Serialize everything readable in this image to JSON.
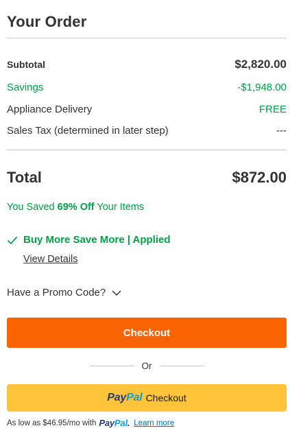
{
  "header": {
    "title": "Your Order"
  },
  "summary": {
    "subtotal": {
      "label": "Subtotal",
      "value": "$2,820.00"
    },
    "savings": {
      "label": "Savings",
      "value": "-$1,948.00"
    },
    "delivery": {
      "label": "Appliance Delivery",
      "value": "FREE"
    },
    "tax": {
      "label": "Sales Tax (determined in later step)",
      "value": "---"
    }
  },
  "total": {
    "label": "Total",
    "value": "$872.00"
  },
  "saved": {
    "prefix": "You Saved ",
    "percent": "69% Off",
    "suffix": " Your Items"
  },
  "promotion": {
    "applied_text": "Buy More Save More | Applied",
    "details_link": "View Details"
  },
  "promo_code": {
    "label": "Have a Promo Code?"
  },
  "checkout": {
    "label": "Checkout"
  },
  "divider": {
    "label": "Or"
  },
  "paypal": {
    "logo_pay": "Pay",
    "logo_pal": "Pal",
    "button_label": "Checkout",
    "as_low_text": "As low as $46.95/mo with",
    "learn_more": "Learn more"
  },
  "colors": {
    "accent": "#f96302",
    "savings_green": "#00a046",
    "paypal_yellow": "#ffc439",
    "paypal_dark": "#253b80",
    "paypal_light": "#179bd7",
    "link_blue": "#0070ba"
  },
  "icons": {
    "applied": "checkmark-icon",
    "promo_toggle": "chevron-down-icon"
  }
}
